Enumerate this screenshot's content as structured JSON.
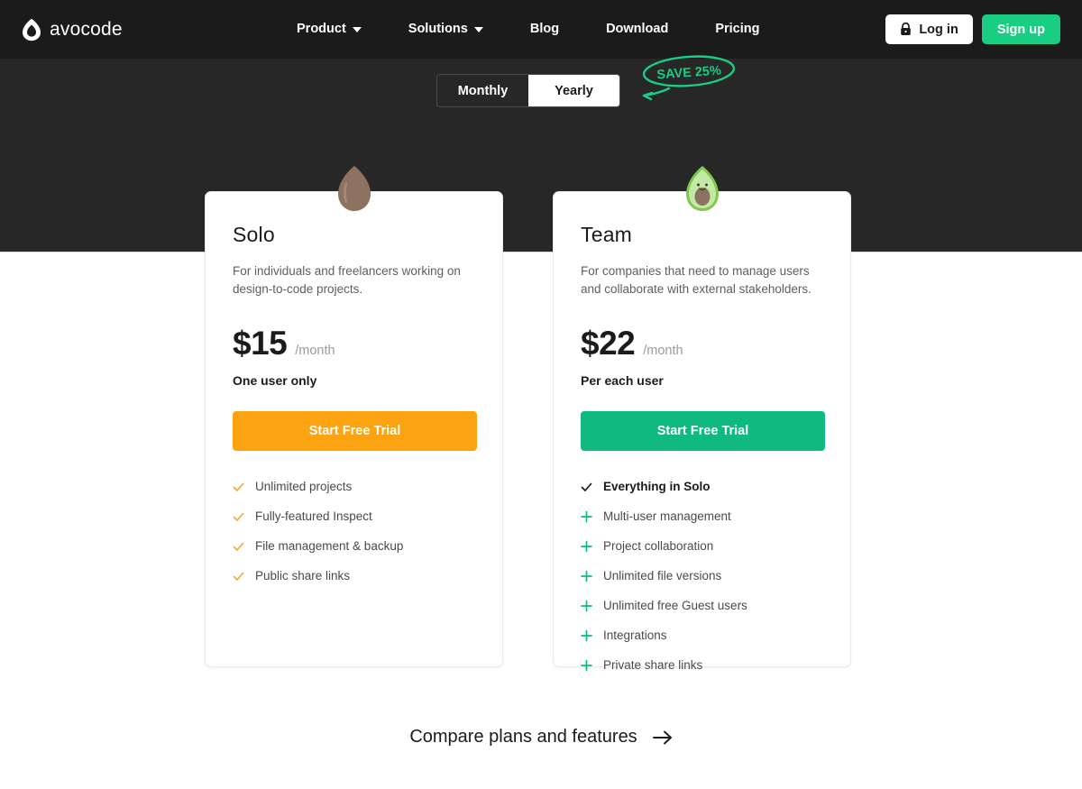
{
  "nav": {
    "brand": {
      "name": "avocode",
      "icon": "avocode-logo-icon"
    },
    "links": [
      {
        "label": "Product",
        "has_caret": true
      },
      {
        "label": "Solutions",
        "has_caret": true
      },
      {
        "label": "Blog",
        "has_caret": false
      },
      {
        "label": "Download",
        "has_caret": false
      },
      {
        "label": "Pricing",
        "has_caret": false
      }
    ],
    "login_label": "Log in",
    "login_icon": "lock-icon",
    "signup_label": "Sign up",
    "signup_color": "#19cd83"
  },
  "billing_toggle": {
    "options": [
      "Monthly",
      "Yearly"
    ],
    "selected": "Yearly",
    "annotation": "SAVE 25%",
    "annotation_color": "#19cd83"
  },
  "plans": [
    {
      "id": "solo",
      "badge_icon": "avocado-pit-icon",
      "title": "Solo",
      "description": "For individuals and freelancers working on design-to-code projects.",
      "price": "$15",
      "period": "/month",
      "price_sub": "One user only",
      "cta_label": "Start Free Trial",
      "cta_color": "#fca311",
      "feature_icon_color": "#f0a830",
      "features": [
        {
          "icon": "check-icon",
          "label": "Unlimited projects",
          "bold": false
        },
        {
          "icon": "check-icon",
          "label": "Fully-featured Inspect",
          "bold": false
        },
        {
          "icon": "check-icon",
          "label": "File management & backup",
          "bold": false
        },
        {
          "icon": "check-icon",
          "label": "Public share links",
          "bold": false
        }
      ]
    },
    {
      "id": "team",
      "badge_icon": "avocado-icon",
      "title": "Team",
      "description": "For companies that need to manage users and collaborate with external stakeholders.",
      "price": "$22",
      "period": "/month",
      "price_sub": "Per each user",
      "cta_label": "Start Free Trial",
      "cta_color": "#0fb97f",
      "feature_icon_color": "#0fb97f",
      "features": [
        {
          "icon": "check-icon",
          "label": "Everything in Solo",
          "bold": true
        },
        {
          "icon": "plus-icon",
          "label": "Multi-user management",
          "bold": false
        },
        {
          "icon": "plus-icon",
          "label": "Project collaboration",
          "bold": false
        },
        {
          "icon": "plus-icon",
          "label": "Unlimited file versions",
          "bold": false
        },
        {
          "icon": "plus-icon",
          "label": "Unlimited free Guest users",
          "bold": false
        },
        {
          "icon": "plus-icon",
          "label": "Integrations",
          "bold": false
        },
        {
          "icon": "plus-icon",
          "label": "Private share links",
          "bold": false
        }
      ]
    }
  ],
  "compare": {
    "label": "Compare plans and features",
    "icon": "arrow-right-icon"
  }
}
